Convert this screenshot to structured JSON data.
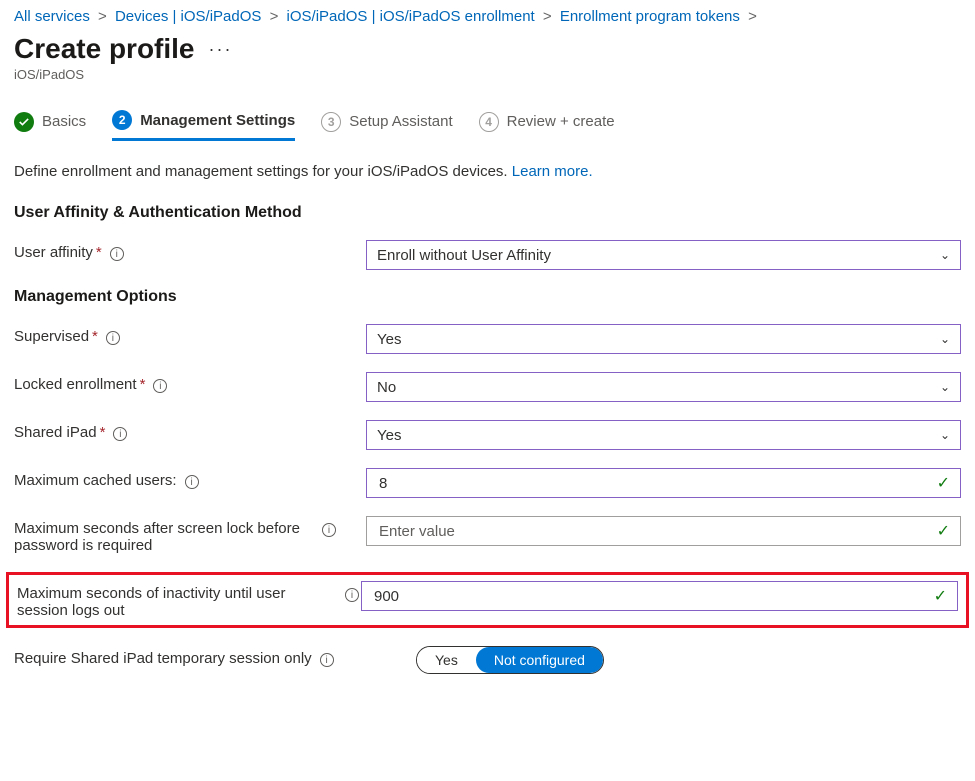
{
  "breadcrumbs": [
    {
      "label": "All services"
    },
    {
      "label": "Devices | iOS/iPadOS"
    },
    {
      "label": "iOS/iPadOS | iOS/iPadOS enrollment"
    },
    {
      "label": "Enrollment program tokens"
    }
  ],
  "page": {
    "title": "Create profile",
    "subtitle": "iOS/iPadOS",
    "ellipsis": "···"
  },
  "tabs": {
    "basics": {
      "num": "",
      "label": "Basics"
    },
    "mgmt": {
      "num": "2",
      "label": "Management Settings"
    },
    "setup": {
      "num": "3",
      "label": "Setup Assistant"
    },
    "review": {
      "num": "4",
      "label": "Review + create"
    }
  },
  "description": {
    "text": "Define enrollment and management settings for your iOS/iPadOS devices. ",
    "link": "Learn more."
  },
  "sections": {
    "auth": "User Affinity & Authentication Method",
    "mgmt": "Management Options"
  },
  "fields": {
    "user_affinity": {
      "label": "User affinity",
      "required": true,
      "value": "Enroll without User Affinity"
    },
    "supervised": {
      "label": "Supervised",
      "required": true,
      "value": "Yes"
    },
    "locked": {
      "label": "Locked enrollment",
      "required": true,
      "value": "No"
    },
    "shared": {
      "label": "Shared iPad",
      "required": true,
      "value": "Yes"
    },
    "max_users": {
      "label": "Maximum cached users:",
      "required": false,
      "value": "8"
    },
    "max_lock": {
      "label": "Maximum seconds after screen lock before password is required",
      "required": false,
      "value": "",
      "placeholder": "Enter value"
    },
    "max_inactive": {
      "label": "Maximum seconds of inactivity until user session logs out",
      "required": false,
      "value": "900"
    },
    "temp_session": {
      "label": "Require Shared iPad temporary session only",
      "required": false,
      "options": [
        "Yes",
        "Not configured"
      ],
      "selected": "Not configured"
    }
  },
  "glyphs": {
    "info": "i",
    "chevron": "⌄",
    "check": "✓",
    "star": "*"
  }
}
